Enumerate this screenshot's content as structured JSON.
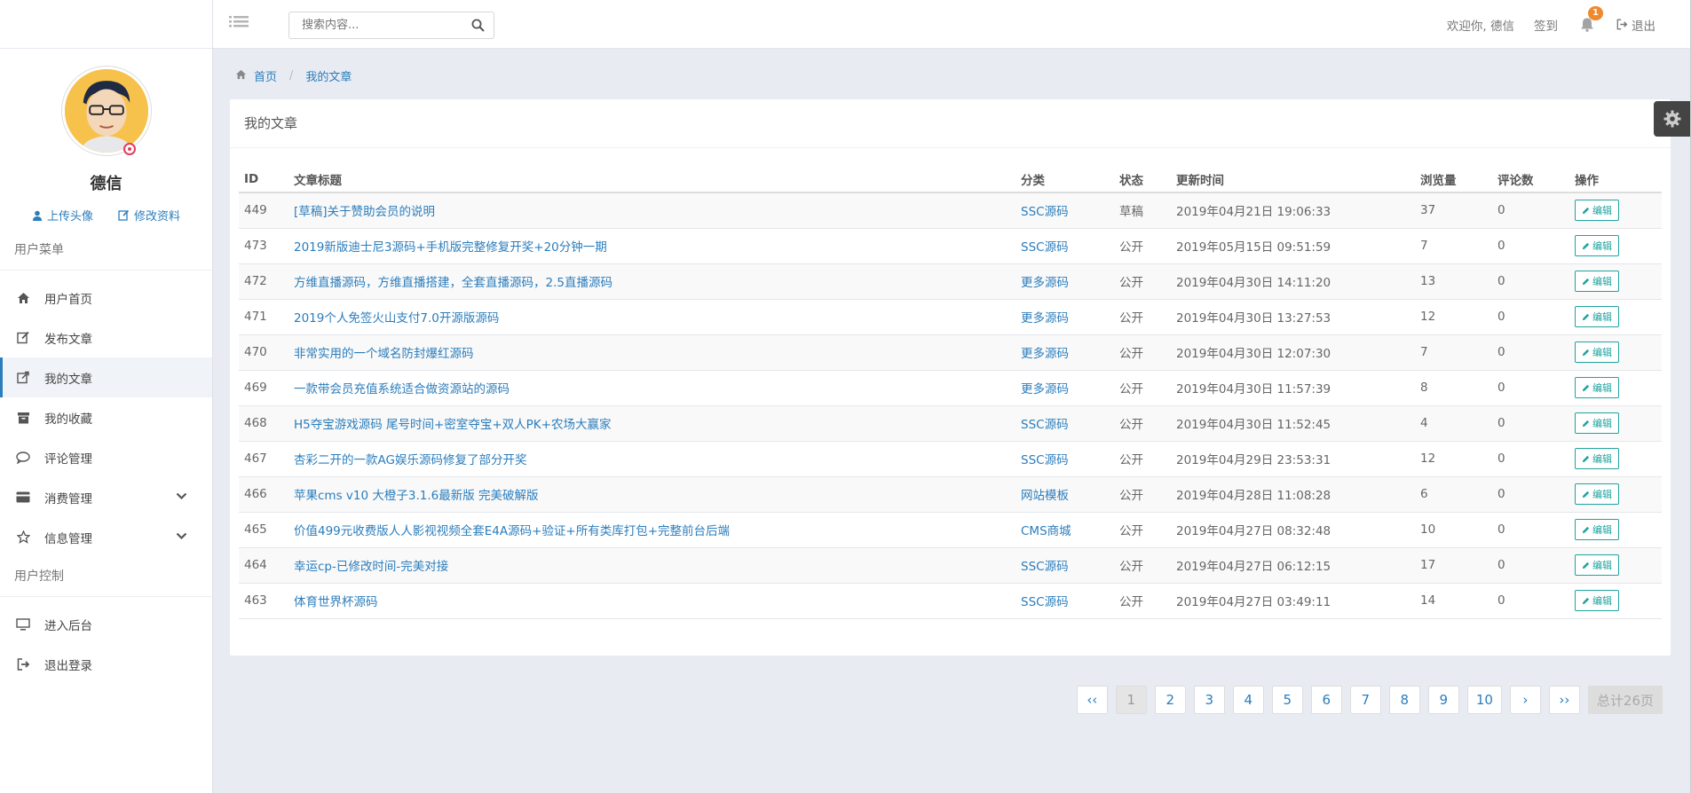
{
  "topbar": {
    "search_placeholder": "搜索内容...",
    "welcome": "欢迎你, 德信",
    "signin": "签到",
    "notification_count": "1",
    "logout": "退出"
  },
  "sidebar": {
    "username": "德信",
    "upload_avatar": "上传头像",
    "edit_profile": "修改资料",
    "user_menu_title": "用户菜单",
    "user_control_title": "用户控制",
    "items": [
      {
        "label": "用户首页",
        "icon": "home-icon"
      },
      {
        "label": "发布文章",
        "icon": "edit-icon"
      },
      {
        "label": "我的文章",
        "icon": "external-link-icon",
        "active": true
      },
      {
        "label": "我的收藏",
        "icon": "archive-icon"
      },
      {
        "label": "评论管理",
        "icon": "comment-icon"
      },
      {
        "label": "消费管理",
        "icon": "credit-card-icon",
        "expandable": true
      },
      {
        "label": "信息管理",
        "icon": "star-icon",
        "expandable": true
      }
    ],
    "control_items": [
      {
        "label": "进入后台",
        "icon": "monitor-icon"
      },
      {
        "label": "退出登录",
        "icon": "sign-out-icon"
      }
    ]
  },
  "breadcrumb": {
    "home": "首页",
    "current": "我的文章"
  },
  "panel": {
    "title": "我的文章",
    "columns": [
      "ID",
      "文章标题",
      "分类",
      "状态",
      "更新时间",
      "浏览量",
      "评论数",
      "操作"
    ],
    "edit_label": "编辑",
    "rows": [
      {
        "id": "449",
        "title": "[草稿]关于赞助会员的说明",
        "category": "SSC源码",
        "status": "草稿",
        "updated": "2019年04月21日 19:06:33",
        "views": "37",
        "comments": "0"
      },
      {
        "id": "473",
        "title": "2019新版迪士尼3源码+手机版完整修复开奖+20分钟一期",
        "category": "SSC源码",
        "status": "公开",
        "updated": "2019年05月15日 09:51:59",
        "views": "7",
        "comments": "0"
      },
      {
        "id": "472",
        "title": "方维直播源码，方维直播搭建，全套直播源码，2.5直播源码",
        "category": "更多源码",
        "status": "公开",
        "updated": "2019年04月30日 14:11:20",
        "views": "13",
        "comments": "0"
      },
      {
        "id": "471",
        "title": "2019个人免签火山支付7.0开源版源码",
        "category": "更多源码",
        "status": "公开",
        "updated": "2019年04月30日 13:27:53",
        "views": "12",
        "comments": "0"
      },
      {
        "id": "470",
        "title": "非常实用的一个域名防封爆红源码",
        "category": "更多源码",
        "status": "公开",
        "updated": "2019年04月30日 12:07:30",
        "views": "7",
        "comments": "0"
      },
      {
        "id": "469",
        "title": "一款带会员充值系统适合做资源站的源码",
        "category": "更多源码",
        "status": "公开",
        "updated": "2019年04月30日 11:57:39",
        "views": "8",
        "comments": "0"
      },
      {
        "id": "468",
        "title": "H5夺宝游戏源码 尾号时间+密室夺宝+双人PK+农场大赢家",
        "category": "SSC源码",
        "status": "公开",
        "updated": "2019年04月30日 11:52:45",
        "views": "4",
        "comments": "0"
      },
      {
        "id": "467",
        "title": "杏彩二开的一款AG娱乐源码修复了部分开奖",
        "category": "SSC源码",
        "status": "公开",
        "updated": "2019年04月29日 23:53:31",
        "views": "12",
        "comments": "0"
      },
      {
        "id": "466",
        "title": "苹果cms v10 大橙子3.1.6最新版 完美破解版",
        "category": "网站模板",
        "status": "公开",
        "updated": "2019年04月28日 11:08:28",
        "views": "6",
        "comments": "0"
      },
      {
        "id": "465",
        "title": "价值499元收费版人人影视视频全套E4A源码+验证+所有类库打包+完整前台后端",
        "category": "CMS商城",
        "status": "公开",
        "updated": "2019年04月27日 08:32:48",
        "views": "10",
        "comments": "0"
      },
      {
        "id": "464",
        "title": "幸运cp-已修改时间-完美对接",
        "category": "SSC源码",
        "status": "公开",
        "updated": "2019年04月27日 06:12:15",
        "views": "17",
        "comments": "0"
      },
      {
        "id": "463",
        "title": "体育世界杯源码",
        "category": "SSC源码",
        "status": "公开",
        "updated": "2019年04月27日 03:49:11",
        "views": "14",
        "comments": "0"
      }
    ]
  },
  "pagination": {
    "first": "‹‹",
    "pages": [
      "1",
      "2",
      "3",
      "4",
      "5",
      "6",
      "7",
      "8",
      "9",
      "10"
    ],
    "current": "1",
    "next": "›",
    "last": "››",
    "total": "总计26页"
  },
  "colors": {
    "link": "#2b7dbc",
    "edit": "#1ea39f",
    "badge": "#f0882d",
    "online": "#e23c5d"
  }
}
